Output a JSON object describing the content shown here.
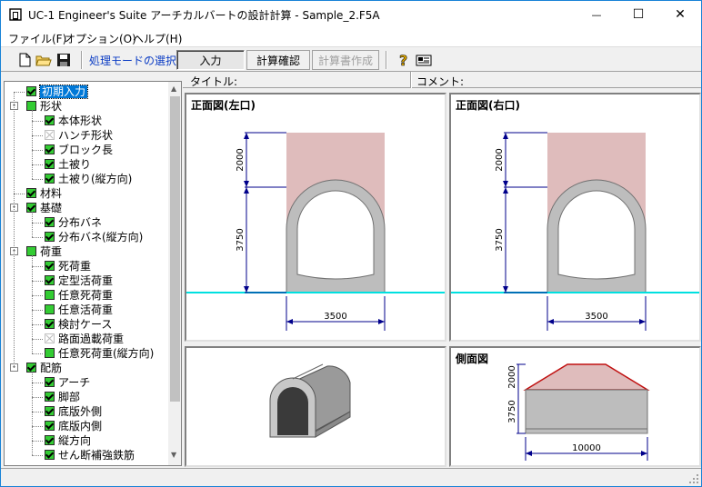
{
  "window": {
    "title": "UC-1 Engineer's Suite アーチカルバートの設計計算 - Sample_2.F5A",
    "minimize_glyph": "—",
    "maximize_glyph": "☐",
    "close_glyph": "✕"
  },
  "menu": [
    {
      "label": "ファイル(F)"
    },
    {
      "label": "オプション(O)"
    },
    {
      "label": "ヘルプ(H)"
    }
  ],
  "toolbar": {
    "mode_label": "処理モードの選択",
    "input_button": "入力",
    "calc_check_button": "計算確認",
    "report_button": "計算書作成",
    "icons": [
      "new-file-icon",
      "open-folder-icon",
      "save-icon",
      "help-icon",
      "info-card-icon"
    ]
  },
  "infobar": {
    "title_label": "タイトル:",
    "comment_label": "コメント:"
  },
  "tree": [
    {
      "label": "初期入力",
      "level": 0,
      "state": "on",
      "selected": true,
      "expander": ""
    },
    {
      "label": "形状",
      "level": 0,
      "state": "part",
      "expander": "−"
    },
    {
      "label": "本体形状",
      "level": 1,
      "state": "on"
    },
    {
      "label": "ハンチ形状",
      "level": 1,
      "state": "off"
    },
    {
      "label": "ブロック長",
      "level": 1,
      "state": "on"
    },
    {
      "label": "土被り",
      "level": 1,
      "state": "on"
    },
    {
      "label": "土被り(縦方向)",
      "level": 1,
      "state": "on"
    },
    {
      "label": "材料",
      "level": 0,
      "state": "on",
      "expander": ""
    },
    {
      "label": "基礎",
      "level": 0,
      "state": "on",
      "expander": "−"
    },
    {
      "label": "分布バネ",
      "level": 1,
      "state": "on"
    },
    {
      "label": "分布バネ(縦方向)",
      "level": 1,
      "state": "on"
    },
    {
      "label": "荷重",
      "level": 0,
      "state": "part",
      "expander": "−"
    },
    {
      "label": "死荷重",
      "level": 1,
      "state": "on"
    },
    {
      "label": "定型活荷重",
      "level": 1,
      "state": "on"
    },
    {
      "label": "任意死荷重",
      "level": 1,
      "state": "part"
    },
    {
      "label": "任意活荷重",
      "level": 1,
      "state": "part"
    },
    {
      "label": "検討ケース",
      "level": 1,
      "state": "on"
    },
    {
      "label": "路面過載荷重",
      "level": 1,
      "state": "off"
    },
    {
      "label": "任意死荷重(縦方向)",
      "level": 1,
      "state": "part"
    },
    {
      "label": "配筋",
      "level": 0,
      "state": "on",
      "expander": "−"
    },
    {
      "label": "アーチ",
      "level": 1,
      "state": "on"
    },
    {
      "label": "脚部",
      "level": 1,
      "state": "on"
    },
    {
      "label": "底版外側",
      "level": 1,
      "state": "on"
    },
    {
      "label": "底版内側",
      "level": 1,
      "state": "on"
    },
    {
      "label": "縦方向",
      "level": 1,
      "state": "on"
    },
    {
      "label": "せん断補強鉄筋",
      "level": 1,
      "state": "on"
    }
  ],
  "panels": {
    "front_left": {
      "title": "正面図(左口)",
      "dim_cover": "2000",
      "dim_height": "3750",
      "dim_width": "3500"
    },
    "front_right": {
      "title": "正面図(右口)",
      "dim_cover": "2000",
      "dim_height": "3750",
      "dim_width": "3500"
    },
    "isometric": {
      "title": ""
    },
    "side": {
      "title": "側面図",
      "dim_cover": "2000",
      "dim_height": "3750",
      "dim_length": "10000"
    }
  },
  "colors": {
    "soil": "#dfbcbc",
    "dim_line": "#00008b",
    "ground_line": "#00e0e0",
    "culvert": "#bdbdbd",
    "side_roof": "#c01010",
    "selection": "#0078d7",
    "check_green": "#33cc33"
  }
}
